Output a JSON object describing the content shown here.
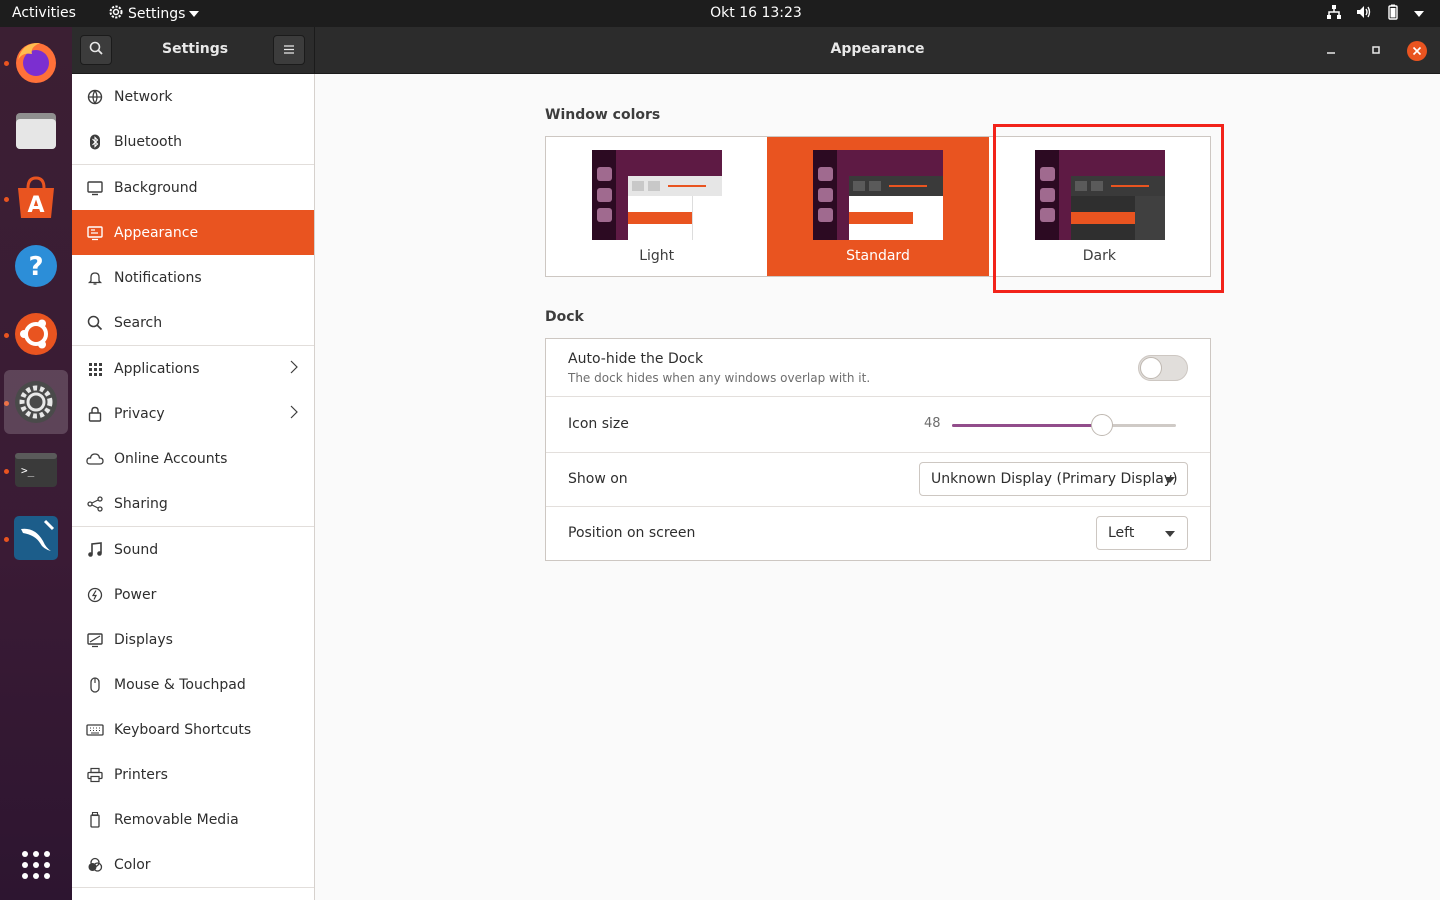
{
  "topbar": {
    "activities": "Activities",
    "app_name": "Settings",
    "clock": "Okt 16  13:23",
    "tray_icons": [
      "network-icon",
      "volume-icon",
      "battery-icon",
      "system-menu-icon"
    ]
  },
  "dock": {
    "apps": [
      {
        "name": "firefox-icon",
        "running": true
      },
      {
        "name": "files-icon",
        "running": false
      },
      {
        "name": "software-icon",
        "running": true
      },
      {
        "name": "help-icon",
        "running": false
      },
      {
        "name": "ubuntu-icon",
        "running": true
      },
      {
        "name": "settings-icon",
        "running": true,
        "active": true
      },
      {
        "name": "terminal-icon",
        "running": true
      },
      {
        "name": "mysql-workbench-icon",
        "running": true
      }
    ],
    "show_apps": "show-applications-icon"
  },
  "header": {
    "sidebar_title": "Settings",
    "page_title": "Appearance"
  },
  "sidebar": {
    "items": [
      {
        "label": "Network",
        "icon": "network-icon"
      },
      {
        "label": "Bluetooth",
        "icon": "bluetooth-icon"
      },
      {
        "label": "Background",
        "icon": "background-icon"
      },
      {
        "label": "Appearance",
        "icon": "appearance-icon",
        "selected": true
      },
      {
        "label": "Notifications",
        "icon": "notifications-icon"
      },
      {
        "label": "Search",
        "icon": "search-icon"
      },
      {
        "label": "Applications",
        "icon": "applications-icon",
        "arrow": true
      },
      {
        "label": "Privacy",
        "icon": "privacy-icon",
        "arrow": true
      },
      {
        "label": "Online Accounts",
        "icon": "online-accounts-icon"
      },
      {
        "label": "Sharing",
        "icon": "sharing-icon"
      },
      {
        "label": "Sound",
        "icon": "sound-icon"
      },
      {
        "label": "Power",
        "icon": "power-icon"
      },
      {
        "label": "Displays",
        "icon": "displays-icon"
      },
      {
        "label": "Mouse & Touchpad",
        "icon": "mouse-icon"
      },
      {
        "label": "Keyboard Shortcuts",
        "icon": "keyboard-icon"
      },
      {
        "label": "Printers",
        "icon": "printer-icon"
      },
      {
        "label": "Removable Media",
        "icon": "removable-media-icon"
      },
      {
        "label": "Color",
        "icon": "color-icon"
      }
    ]
  },
  "appearance": {
    "window_colors_title": "Window colors",
    "options": [
      {
        "label": "Light"
      },
      {
        "label": "Standard",
        "selected": true
      },
      {
        "label": "Dark"
      }
    ],
    "dock_title": "Dock",
    "autohide": {
      "title": "Auto-hide the Dock",
      "subtitle": "The dock hides when any windows overlap with it.",
      "enabled": false
    },
    "icon_size": {
      "title": "Icon size",
      "value": "48",
      "fraction": 0.67
    },
    "show_on": {
      "title": "Show on",
      "value": "Unknown Display (Primary Display)"
    },
    "position": {
      "title": "Position on screen",
      "value": "Left"
    }
  },
  "colors": {
    "accent": "#e95420",
    "highlight": "#f2231a",
    "slider": "#924d8b"
  }
}
